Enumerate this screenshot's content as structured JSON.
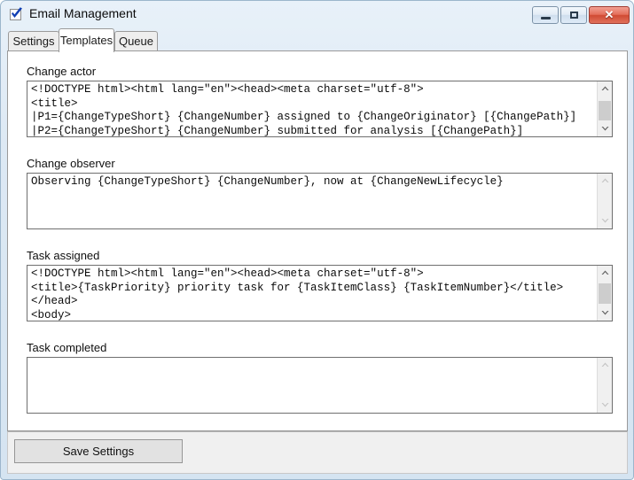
{
  "window": {
    "title": "Email Management",
    "icon": "checkbox-checked-icon",
    "controls": {
      "minimize_label": "—",
      "maximize_label": "□",
      "close_label": "✕"
    },
    "frame_color": "#d5e4f1",
    "close_color": "#d04b34"
  },
  "tabs": [
    {
      "label": "Settings",
      "active": false
    },
    {
      "label": "Templates",
      "active": true
    },
    {
      "label": "Queue",
      "active": false
    }
  ],
  "fields": [
    {
      "label": "Change actor",
      "value": "<!DOCTYPE html><html lang=\"en\"><head><meta charset=\"utf-8\">\n<title>\n|P1={ChangeTypeShort} {ChangeNumber} assigned to {ChangeOriginator} [{ChangePath}]\n|P2={ChangeTypeShort} {ChangeNumber} submitted for analysis [{ChangePath}]\n|",
      "scroll": {
        "enabled": true,
        "thumb_top_pct": 26,
        "thumb_height_pct": 34
      }
    },
    {
      "label": "Change observer",
      "value": "Observing {ChangeTypeShort} {ChangeNumber}, now at {ChangeNewLifecycle}",
      "scroll": {
        "enabled": false,
        "thumb_top_pct": 0,
        "thumb_height_pct": 0
      }
    },
    {
      "label": "Task assigned",
      "value": "<!DOCTYPE html><html lang=\"en\"><head><meta charset=\"utf-8\">\n<title>{TaskPriority} priority task for {TaskItemClass} {TaskItemNumber}</title>\n</head>\n<body>",
      "scroll": {
        "enabled": true,
        "thumb_top_pct": 24,
        "thumb_height_pct": 36
      }
    },
    {
      "label": "Task completed",
      "value": "",
      "scroll": {
        "enabled": false,
        "thumb_top_pct": 0,
        "thumb_height_pct": 0
      }
    }
  ],
  "footer": {
    "save_label": "Save Settings"
  }
}
